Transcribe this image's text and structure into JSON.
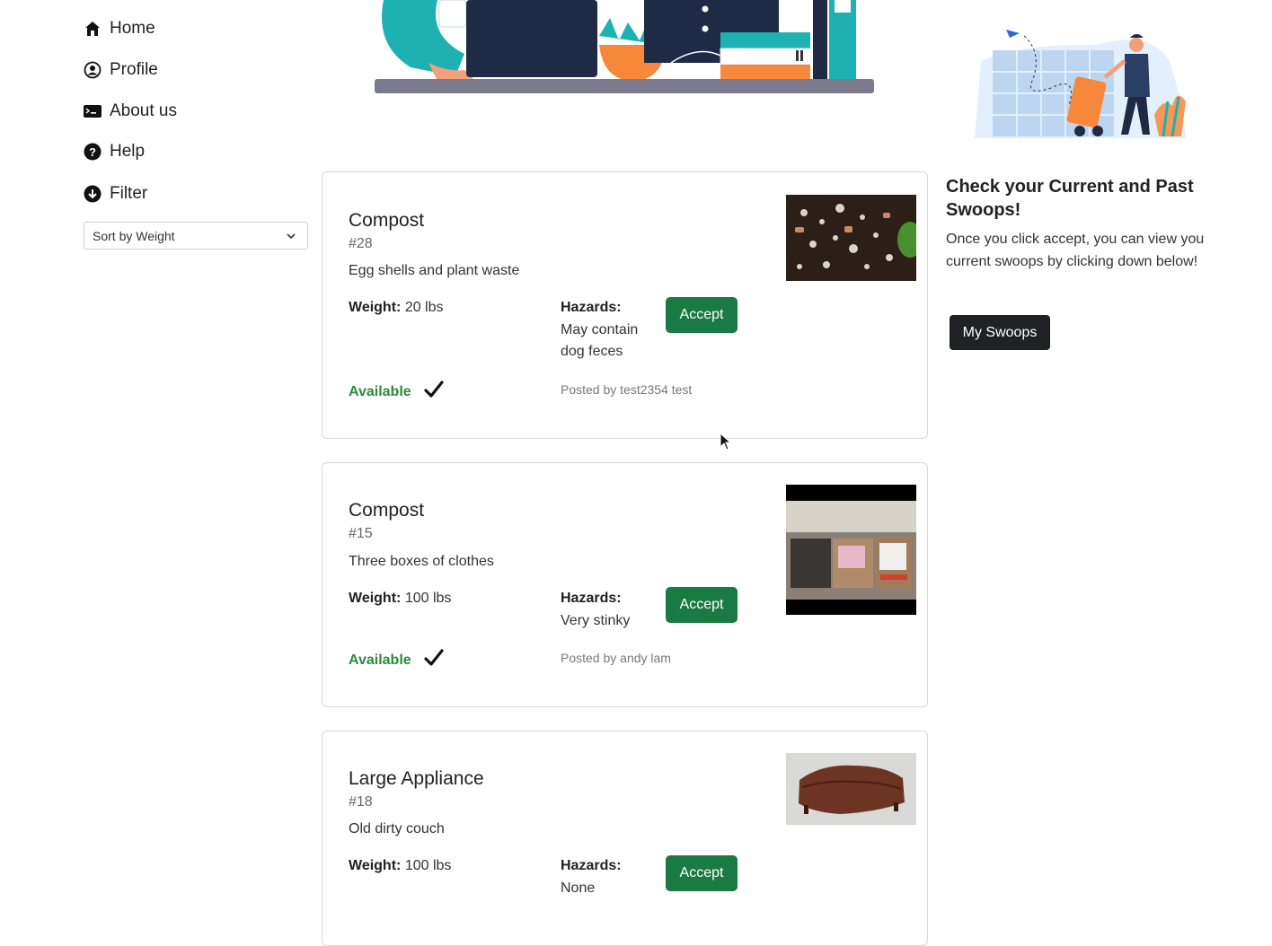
{
  "sidebar": {
    "items": [
      {
        "label": "Home",
        "icon": "home-icon"
      },
      {
        "label": "Profile",
        "icon": "user-circle-icon"
      },
      {
        "label": "About us",
        "icon": "terminal-icon"
      },
      {
        "label": "Help",
        "icon": "question-icon"
      },
      {
        "label": "Filter",
        "icon": "arrow-down-circle-icon"
      }
    ],
    "sort": {
      "selected": "Sort by Weight"
    }
  },
  "listings": [
    {
      "title": "Compost",
      "number": "#28",
      "description": "Egg shells and plant waste",
      "weight_label": "Weight:",
      "weight": "20 lbs",
      "hazards_label": "Hazards:",
      "hazards": "May contain dog feces",
      "accept_label": "Accept",
      "status": "Available",
      "posted_by": "Posted by test2354 test"
    },
    {
      "title": "Compost",
      "number": "#15",
      "description": "Three boxes of clothes",
      "weight_label": "Weight:",
      "weight": "100 lbs",
      "hazards_label": "Hazards:",
      "hazards": "Very stinky",
      "accept_label": "Accept",
      "status": "Available",
      "posted_by": "Posted by andy lam"
    },
    {
      "title": "Large Appliance",
      "number": "#18",
      "description": "Old dirty couch",
      "weight_label": "Weight:",
      "weight": "100 lbs",
      "hazards_label": "Hazards:",
      "hazards": "None",
      "accept_label": "Accept"
    }
  ],
  "right_panel": {
    "title": "Check your Current and Past Swoops!",
    "text": "Once you click accept, you can view you current swoops by clicking down below!",
    "button": "My Swoops"
  },
  "colors": {
    "accept": "#1a7a43",
    "available": "#2d8a3a",
    "dark_button": "#202124"
  }
}
